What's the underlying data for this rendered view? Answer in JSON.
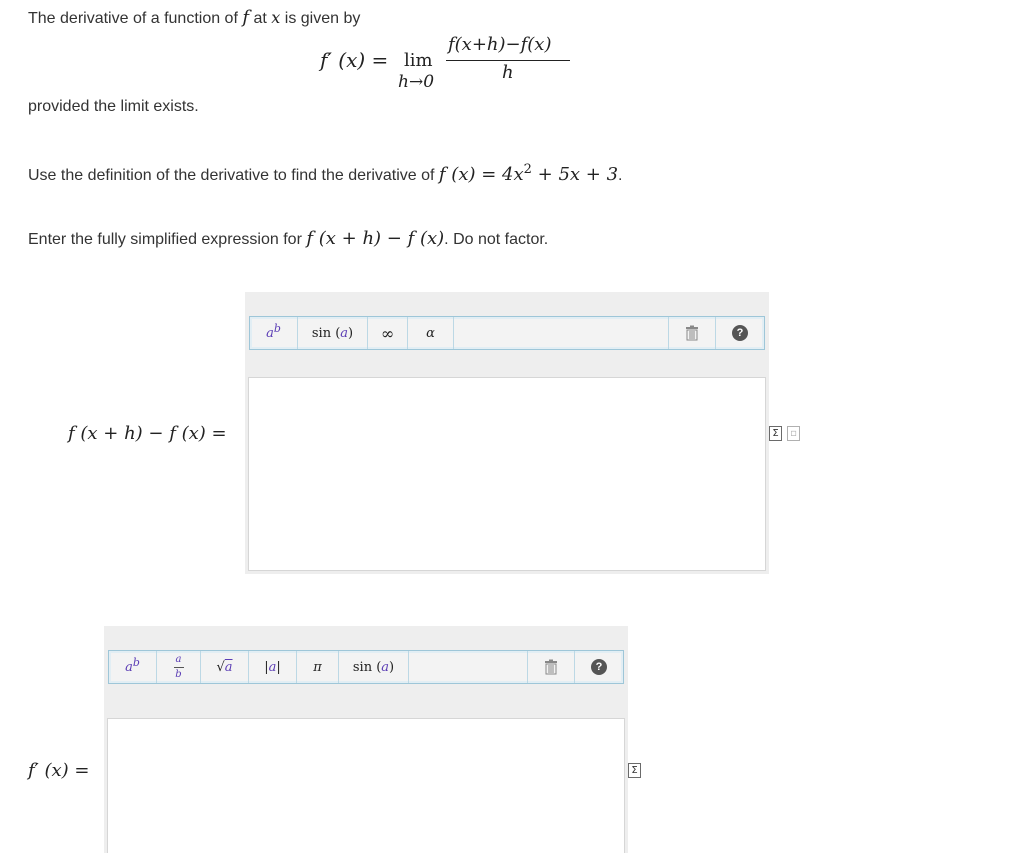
{
  "intro": {
    "part1": "The derivative of a function of",
    "f": "f",
    "part2": "at",
    "x": "x",
    "part3": "is given by"
  },
  "formula": {
    "lhs": "f′ (x) =",
    "lim": "lim",
    "under": "h→0",
    "numerator": "f(x+h)−f(x)",
    "denominator": "h"
  },
  "provided": "provided the limit exists.",
  "task": {
    "text": "Use the definition of the derivative to find the derivative of",
    "math": "f (x) = 4x",
    "exp": "2",
    "math_tail": "+ 5x + 3",
    "end": "."
  },
  "instruction": {
    "text": "Enter the fully simplified expression for",
    "math": "f (x + h) − f (x)",
    "end": ". Do not factor."
  },
  "question1": {
    "label": "f (x + h) − f (x) =",
    "toolbar": [
      {
        "name": "superscript-button",
        "label": "ab"
      },
      {
        "name": "sin-button",
        "label": "sin (a)"
      },
      {
        "name": "infinity-button",
        "label": "∞"
      },
      {
        "name": "alpha-button",
        "label": "α"
      }
    ],
    "value": ""
  },
  "question2": {
    "label": "f′ (x) =",
    "toolbar": [
      {
        "name": "superscript-button",
        "label": "ab"
      },
      {
        "name": "fraction-button",
        "label": "a/b"
      },
      {
        "name": "sqrt-button",
        "label": "√a"
      },
      {
        "name": "abs-button",
        "label": "|a|"
      },
      {
        "name": "pi-button",
        "label": "π"
      },
      {
        "name": "sin-button",
        "label": "sin (a)"
      }
    ],
    "value": ""
  },
  "icons": {
    "trash": "trash-icon",
    "help": "help-icon",
    "help_glyph": "?",
    "equation_editor": "equation-editor-icon",
    "preview": "preview-icon"
  }
}
